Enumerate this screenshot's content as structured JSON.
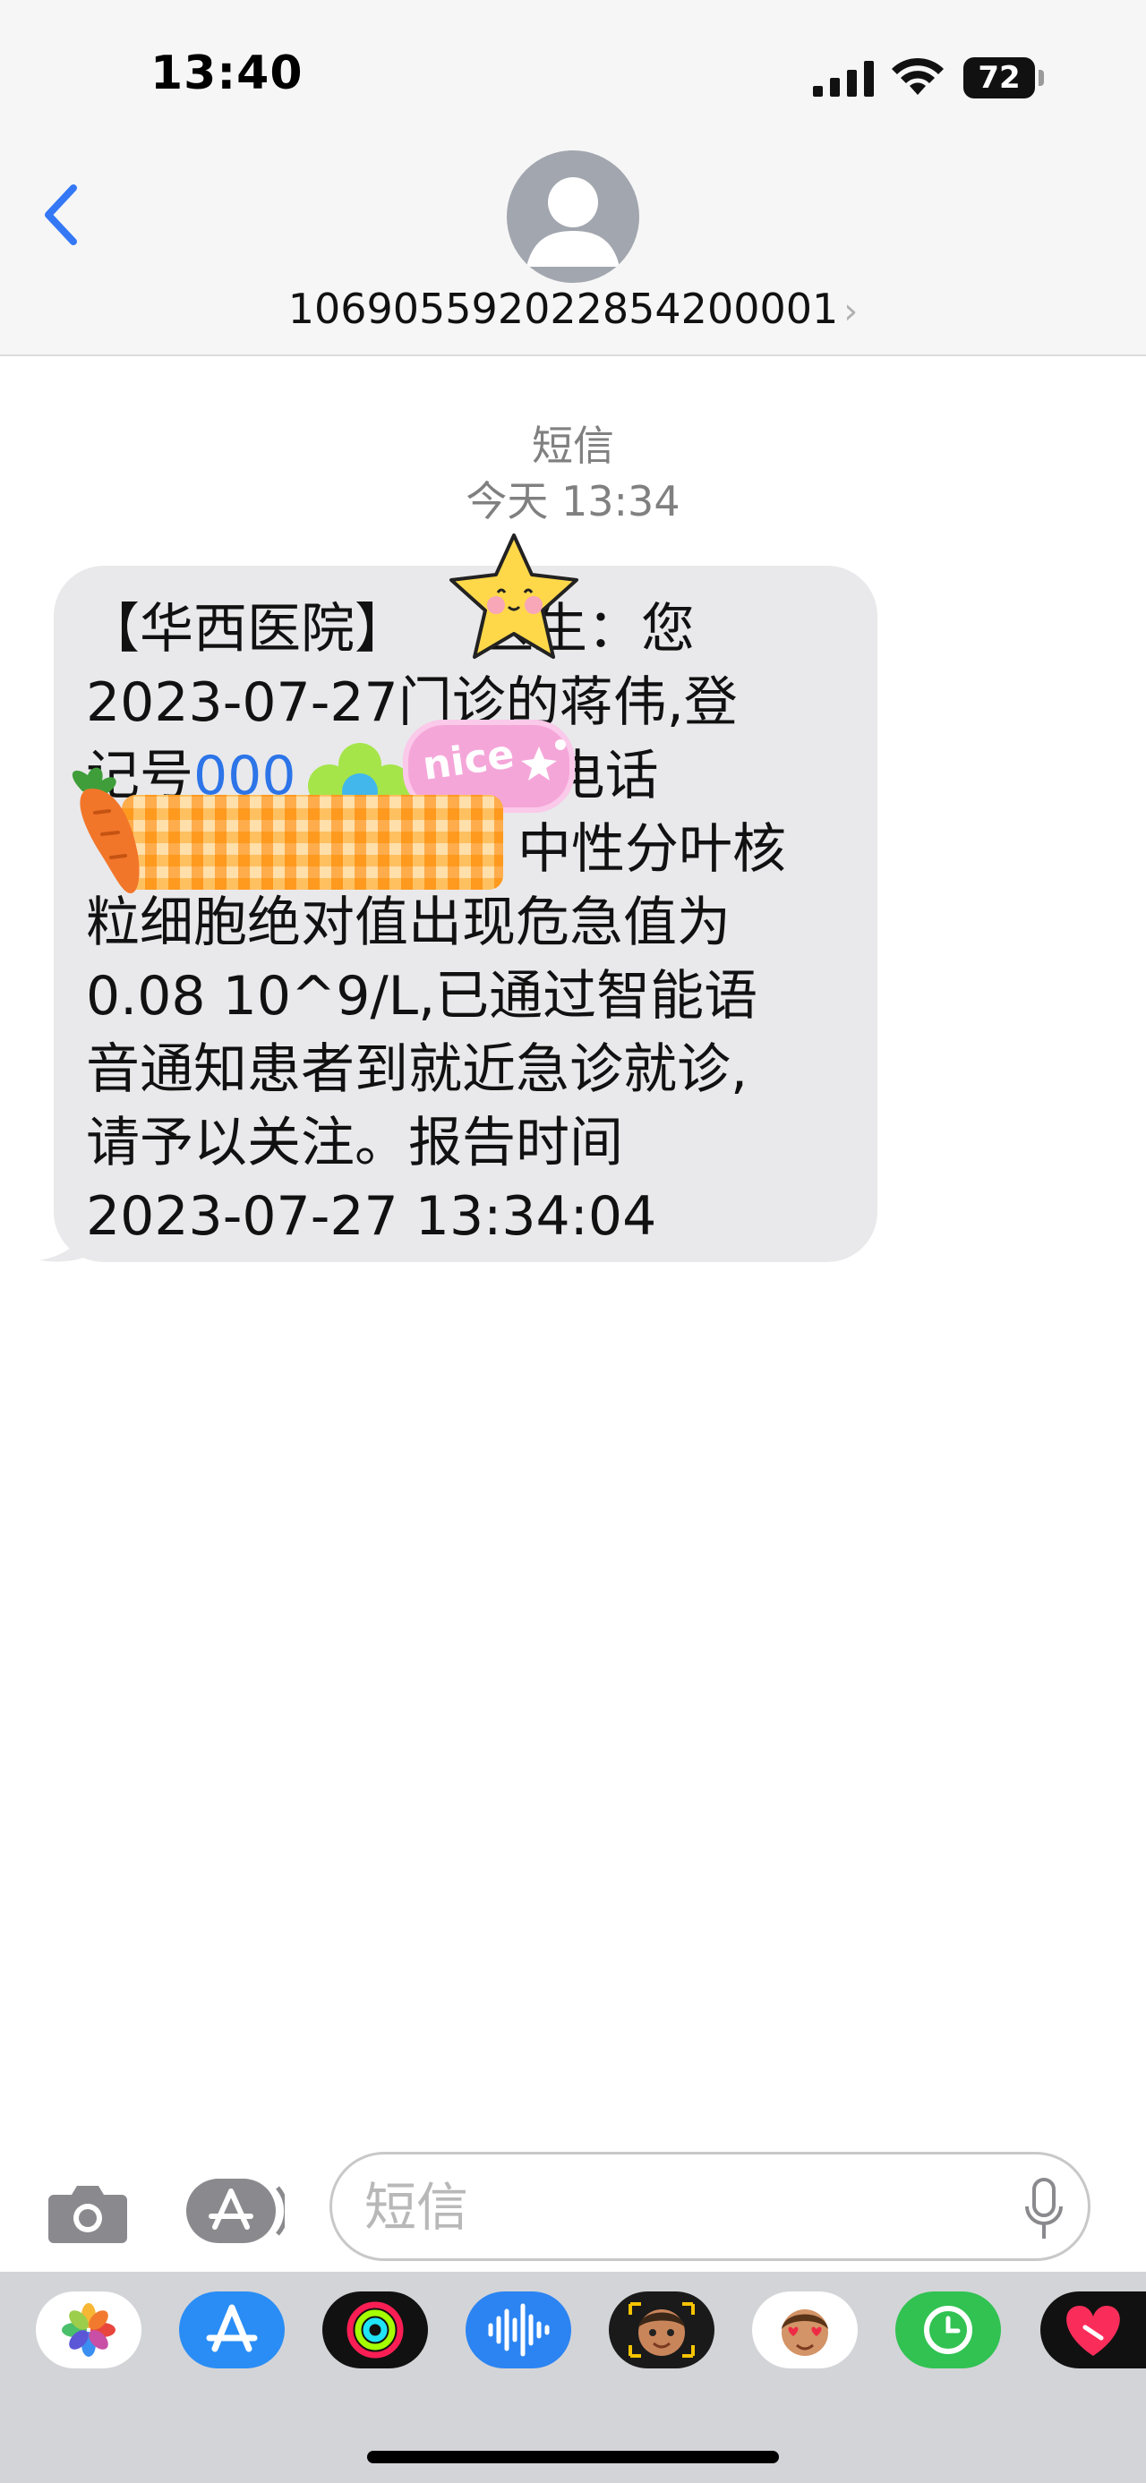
{
  "status_bar": {
    "time": "13:40",
    "battery_level": "72"
  },
  "header": {
    "contact_number": "106905592022854200001"
  },
  "conversation": {
    "service_label": "短信",
    "timestamp": "今天 13:34",
    "message": {
      "line1": "【华西医院】",
      "line1b": "医生：您",
      "line2": "2023-07-27门诊的蒋伟,登",
      "line3_prefix": "记号",
      "line3_link": "000",
      "line3_suffix": ",电话",
      "line4_suffix": "中性分叶核",
      "line5": "粒细胞绝对值出现危急值为",
      "line6": "0.08 10^9/L,已通过智能语",
      "line7": "音通知患者到就近急诊就诊,",
      "line8": "请予以关注。报告时间",
      "line9": "2023-07-27 13:34:04"
    },
    "sticker_text": "nice"
  },
  "composer": {
    "placeholder": "短信"
  },
  "colors": {
    "link": "#2c74e8",
    "back_arrow": "#3478f6",
    "bubble": "#e9e9eb"
  }
}
